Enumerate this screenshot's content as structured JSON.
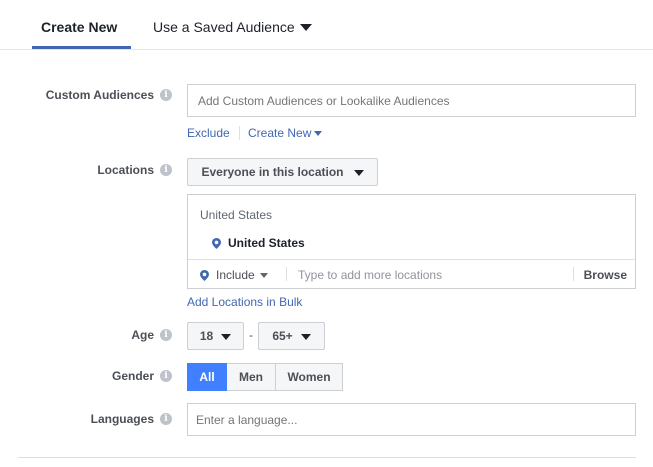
{
  "tabs": {
    "create_new": "Create New",
    "saved_audience": "Use a Saved Audience"
  },
  "custom_audiences": {
    "label": "Custom Audiences",
    "placeholder": "Add Custom Audiences or Lookalike Audiences",
    "exclude": "Exclude",
    "create_new": "Create New"
  },
  "locations": {
    "label": "Locations",
    "dropdown": "Everyone in this location",
    "country_header": "United States",
    "selected": "United States",
    "include": "Include",
    "search_placeholder": "Type to add more locations",
    "browse": "Browse",
    "bulk_link": "Add Locations in Bulk"
  },
  "age": {
    "label": "Age",
    "min": "18",
    "dash": "-",
    "max": "65+"
  },
  "gender": {
    "label": "Gender",
    "options": [
      "All",
      "Men",
      "Women"
    ],
    "selected": "All"
  },
  "languages": {
    "label": "Languages",
    "placeholder": "Enter a language..."
  },
  "icons": {
    "info": "i",
    "accent": "#4267b2",
    "active_segment": "#4080ff"
  }
}
